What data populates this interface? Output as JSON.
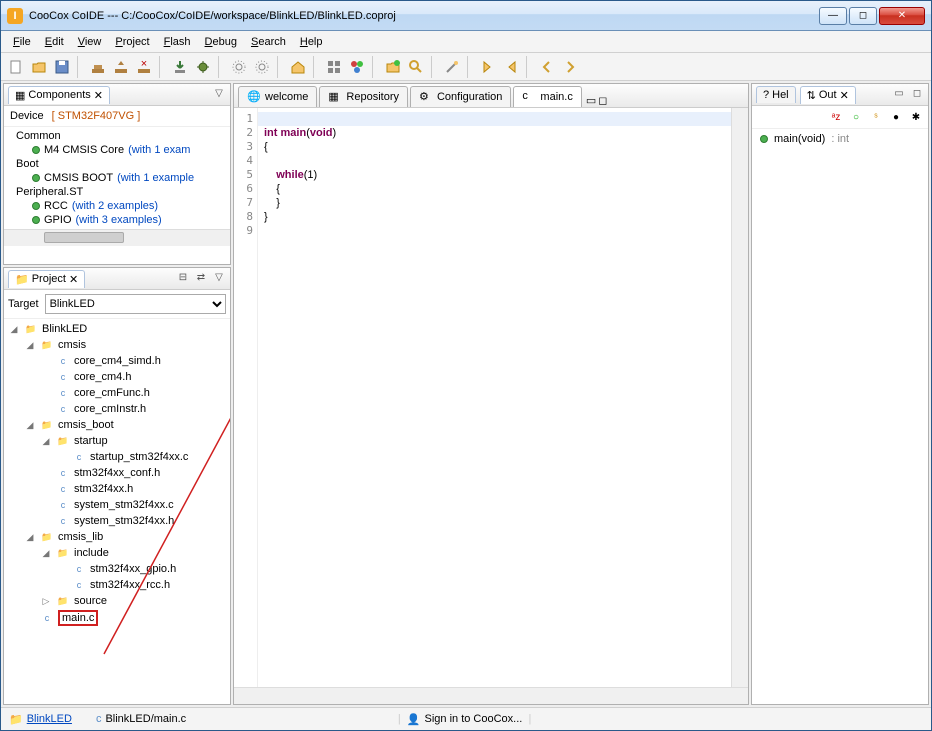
{
  "window": {
    "title": "CooCox CoIDE --- C:/CooCox/CoIDE/workspace/BlinkLED/BlinkLED.coproj",
    "app_icon_letter": "I"
  },
  "menu": [
    "File",
    "Edit",
    "View",
    "Project",
    "Flash",
    "Debug",
    "Search",
    "Help"
  ],
  "components": {
    "tab_label": "Components",
    "device_label": "Device",
    "device_value": "[ STM32F407VG ]",
    "groups": [
      {
        "name": "Common",
        "items": [
          {
            "label": "M4 CMSIS Core",
            "link": "(with 1 exam"
          }
        ]
      },
      {
        "name": "Boot",
        "items": [
          {
            "label": "CMSIS BOOT",
            "link": "(with 1 example"
          }
        ]
      },
      {
        "name": "Peripheral.ST",
        "items": [
          {
            "label": "RCC",
            "link": "(with 2 examples)"
          },
          {
            "label": "GPIO",
            "link": "(with 3 examples)"
          }
        ]
      }
    ]
  },
  "project": {
    "tab_label": "Project",
    "target_label": "Target",
    "target_value": "BlinkLED",
    "tree": {
      "root": "BlinkLED",
      "nodes": [
        {
          "d": 1,
          "t": "folder",
          "open": true,
          "label": "cmsis"
        },
        {
          "d": 2,
          "t": "file",
          "label": "core_cm4_simd.h"
        },
        {
          "d": 2,
          "t": "file",
          "label": "core_cm4.h"
        },
        {
          "d": 2,
          "t": "file",
          "label": "core_cmFunc.h"
        },
        {
          "d": 2,
          "t": "file",
          "label": "core_cmInstr.h"
        },
        {
          "d": 1,
          "t": "folder",
          "open": true,
          "label": "cmsis_boot"
        },
        {
          "d": 2,
          "t": "folder",
          "open": true,
          "label": "startup"
        },
        {
          "d": 3,
          "t": "file",
          "label": "startup_stm32f4xx.c"
        },
        {
          "d": 2,
          "t": "file",
          "label": "stm32f4xx_conf.h"
        },
        {
          "d": 2,
          "t": "file",
          "label": "stm32f4xx.h"
        },
        {
          "d": 2,
          "t": "file",
          "label": "system_stm32f4xx.c"
        },
        {
          "d": 2,
          "t": "file",
          "label": "system_stm32f4xx.h"
        },
        {
          "d": 1,
          "t": "folder",
          "open": true,
          "label": "cmsis_lib"
        },
        {
          "d": 2,
          "t": "folder",
          "open": true,
          "label": "include"
        },
        {
          "d": 3,
          "t": "file",
          "label": "stm32f4xx_gpio.h"
        },
        {
          "d": 3,
          "t": "file",
          "label": "stm32f4xx_rcc.h"
        },
        {
          "d": 2,
          "t": "folder",
          "open": false,
          "label": "source"
        },
        {
          "d": 1,
          "t": "file",
          "label": "main.c",
          "selected": true
        }
      ]
    }
  },
  "editor": {
    "tabs": [
      {
        "label": "welcome",
        "icon": "globe"
      },
      {
        "label": "Repository",
        "icon": "repo"
      },
      {
        "label": "Configuration",
        "icon": "gear"
      },
      {
        "label": "main.c",
        "icon": "cfile",
        "active": true
      }
    ],
    "lines": [
      "",
      [
        "kw:int",
        " ",
        "kw:main",
        "(",
        "kw:void",
        ")"
      ],
      "{",
      "",
      [
        "    ",
        "kw:while",
        "(1)"
      ],
      "    {",
      "    }",
      "}",
      ""
    ]
  },
  "outline": {
    "tabs": [
      {
        "label": "Hel"
      },
      {
        "label": "Out",
        "active": true
      }
    ],
    "item": {
      "name": "main(void)",
      "ret": ": int"
    }
  },
  "status": {
    "left_link": "BlinkLED",
    "left_path": "BlinkLED/main.c",
    "center": "Sign in to CooCox..."
  }
}
